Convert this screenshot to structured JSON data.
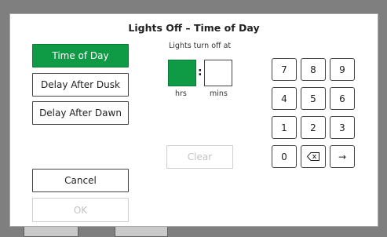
{
  "dialog": {
    "title": "Lights Off – Time of Day",
    "mode_buttons": [
      {
        "label": "Time of Day",
        "selected": true
      },
      {
        "label": "Delay After Dusk",
        "selected": false
      },
      {
        "label": "Delay After Dawn",
        "selected": false
      }
    ],
    "cancel_label": "Cancel",
    "ok_label": "OK",
    "time_entry": {
      "heading": "Lights turn off at",
      "separator": ":",
      "hours_label": "hrs",
      "minutes_label": "mins",
      "hours_value": "",
      "minutes_value": ""
    },
    "clear_label": "Clear",
    "keypad": {
      "keys": [
        "7",
        "8",
        "9",
        "4",
        "5",
        "6",
        "1",
        "2",
        "3",
        "0"
      ],
      "backspace_icon": "backspace-icon",
      "enter_symbol": "→"
    },
    "colors": {
      "accent_green": "#0f9a45",
      "backdrop": "#7f7f7f"
    }
  }
}
